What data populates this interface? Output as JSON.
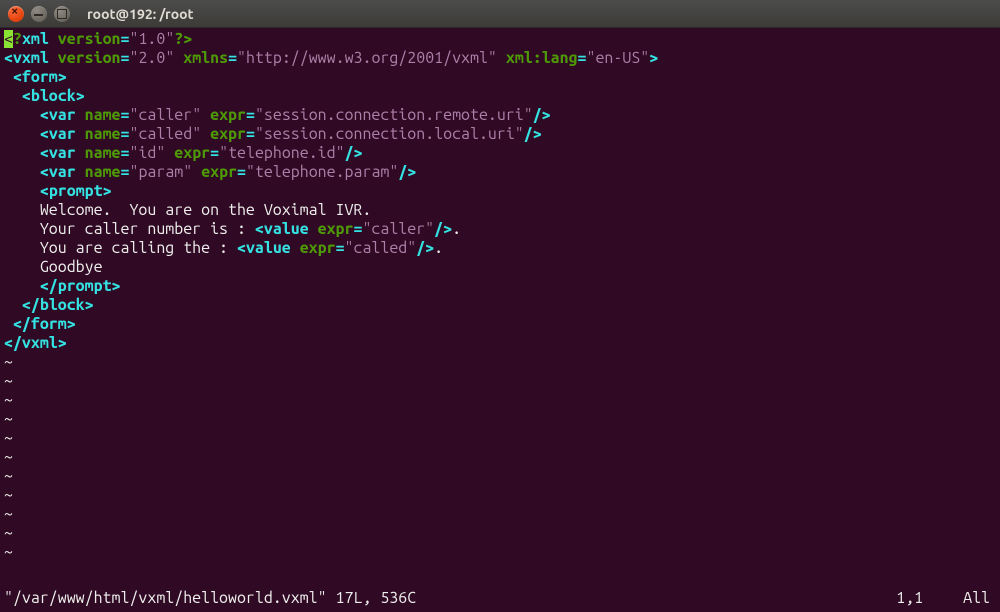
{
  "window": {
    "title": "root@192: /root"
  },
  "vim": {
    "status_file": "\"/var/www/html/vxml/helloworld.vxml\" 17L, 536C",
    "status_pos": "1,1",
    "status_all": "All"
  },
  "lines": {
    "l0_lt": "<",
    "l0_q1": "?",
    "l0_xml": "xml",
    "l0_sp": " ",
    "l0_verK": "version",
    "l0_eq": "=",
    "l0_verV": "\"1.0\"",
    "l0_close": "?>",
    "l1_lt": "<",
    "l1_tag": "vxml",
    "l1_a1k": "version",
    "l1_a1v": "\"2.0\"",
    "l1_a2k": "xmlns",
    "l1_a2v": "\"http://www.w3.org/2001/vxml\"",
    "l1_a3k": "xml:lang",
    "l1_a3v": "\"en-US\"",
    "l1_gt": ">",
    "l2_open": " <",
    "l2_tag": "form",
    "l2_gt": ">",
    "l3_open": "  <",
    "l3_tag": "block",
    "l3_gt": ">",
    "l4_open": "    <",
    "l4_tag": "var",
    "l4_a1k": "name",
    "l4_a1v": "\"caller\"",
    "l4_a2k": "expr",
    "l4_a2v": "\"session.connection.remote.uri\"",
    "l4_close": "/>",
    "l5_open": "    <",
    "l5_tag": "var",
    "l5_a1k": "name",
    "l5_a1v": "\"called\"",
    "l5_a2k": "expr",
    "l5_a2v": "\"session.connection.local.uri\"",
    "l5_close": "/>",
    "l6_open": "    <",
    "l6_tag": "var",
    "l6_a1k": "name",
    "l6_a1v": "\"id\"",
    "l6_a2k": "expr",
    "l6_a2v": "\"telephone.id\"",
    "l6_close": "/>",
    "l7_open": "    <",
    "l7_tag": "var",
    "l7_a1k": "name",
    "l7_a1v": "\"param\"",
    "l7_a2k": "expr",
    "l7_a2v": "\"telephone.param\"",
    "l7_close": "/>",
    "l8_open": "    <",
    "l8_tag": "prompt",
    "l8_gt": ">",
    "l9_text": "    Welcome.  You are on the Voximal IVR.",
    "l10_pre": "    Your caller number is : ",
    "l10_lt": "<",
    "l10_tag": "value",
    "l10_ak": "expr",
    "l10_av": "\"caller\"",
    "l10_close": "/>",
    "l10_post": ".",
    "l11_pre": "    You are calling the : ",
    "l11_lt": "<",
    "l11_tag": "value",
    "l11_ak": "expr",
    "l11_av": "\"called\"",
    "l11_close": "/>",
    "l11_post": ".",
    "l12_text": "    Goodbye",
    "l13_open": "    </",
    "l13_tag": "prompt",
    "l13_gt": ">",
    "l14_open": "  </",
    "l14_tag": "block",
    "l14_gt": ">",
    "l15_open": " </",
    "l15_tag": "form",
    "l15_gt": ">",
    "l16_open": "</",
    "l16_tag": "vxml",
    "l16_gt": ">",
    "tilde": "~"
  }
}
